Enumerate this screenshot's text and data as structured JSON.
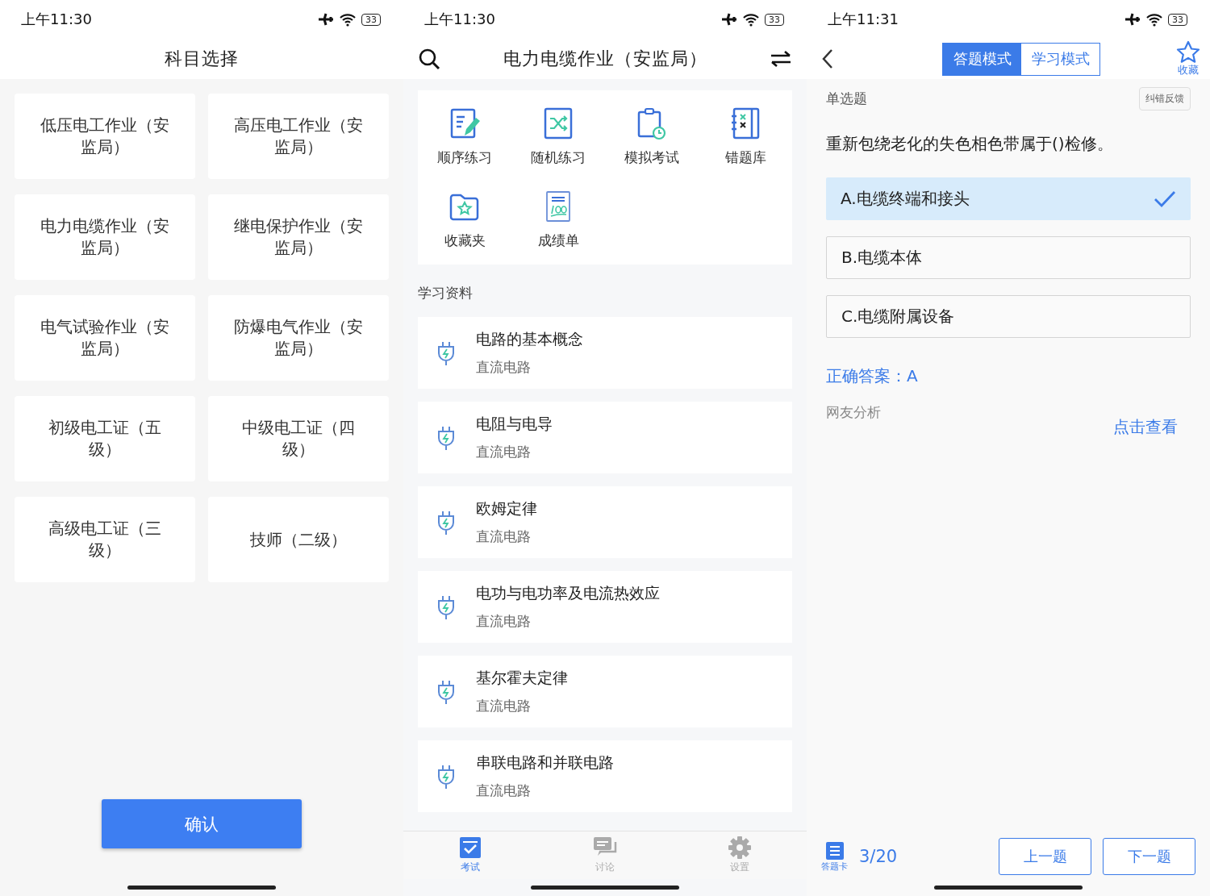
{
  "subject_screen": {
    "status_bar": {
      "time": "上午11:30",
      "battery": "33"
    },
    "title": "科目选择",
    "subjects": [
      {
        "label": "低压电工作业（安监局）",
        "selected": false
      },
      {
        "label": "高压电工作业（安监局）",
        "selected": false
      },
      {
        "label": "电力电缆作业（安监局）",
        "selected": false
      },
      {
        "label": "继电保护作业（安监局）",
        "selected": false
      },
      {
        "label": "电气试验作业（安监局）",
        "selected": false
      },
      {
        "label": "防爆电气作业（安监局）",
        "selected": false
      },
      {
        "label": "初级电工证（五级）",
        "selected": false
      },
      {
        "label": "中级电工证（四级）",
        "selected": false
      },
      {
        "label": "高级电工证（三级）",
        "selected": false
      },
      {
        "label": "技师（二级）",
        "selected": false
      }
    ],
    "confirm_button": "确认"
  },
  "home_screen": {
    "status_bar": {
      "time": "上午11:30",
      "battery": "33"
    },
    "title": "电力电缆作业（安监局）",
    "features": [
      {
        "kind": "sequence",
        "label": "顺序练习"
      },
      {
        "kind": "random",
        "label": "随机练习"
      },
      {
        "kind": "exam",
        "label": "模拟考试"
      },
      {
        "kind": "mistakes",
        "label": "错题库"
      },
      {
        "kind": "favorites",
        "label": "收藏夹"
      },
      {
        "kind": "scores",
        "label": "成绩单"
      }
    ],
    "section_title": "学习资料",
    "materials": [
      {
        "title": "电路的基本概念",
        "subtitle": "直流电路"
      },
      {
        "title": "电阻与电导",
        "subtitle": "直流电路"
      },
      {
        "title": "欧姆定律",
        "subtitle": "直流电路"
      },
      {
        "title": "电功与电功率及电流热效应",
        "subtitle": "直流电路"
      },
      {
        "title": "基尔霍夫定律",
        "subtitle": "直流电路"
      },
      {
        "title": "串联电路和并联电路",
        "subtitle": "直流电路"
      }
    ],
    "nav": [
      {
        "kind": "exam",
        "label": "考试",
        "selected": true
      },
      {
        "kind": "discuss",
        "label": "讨论",
        "selected": false
      },
      {
        "kind": "settings",
        "label": "设置",
        "selected": false
      }
    ]
  },
  "question_screen": {
    "status_bar": {
      "time": "上午11:31",
      "battery": "33"
    },
    "modes": [
      {
        "label": "答题模式",
        "selected": true
      },
      {
        "label": "学习模式",
        "selected": false
      }
    ],
    "favorite_label": "收藏",
    "question_type": "单选题",
    "feedback_button": "纠错反馈",
    "question": "重新包绕老化的失色相色带属于()检修。",
    "options": [
      {
        "label": "A.电缆终端和接头",
        "selected": true
      },
      {
        "label": "B.电缆本体",
        "selected": false
      },
      {
        "label": "C.电缆附属设备",
        "selected": false
      }
    ],
    "correct_answer": "正确答案：A",
    "analysis_label": "网友分析",
    "analysis_link": "点击查看",
    "answer_card_label": "答题卡",
    "progress": "3/20",
    "prev_button": "上一题",
    "next_button": "下一题"
  }
}
